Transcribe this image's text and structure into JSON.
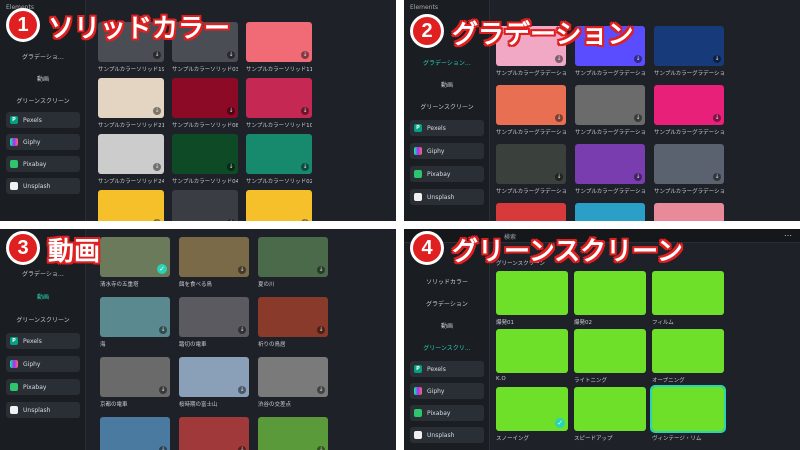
{
  "q1": {
    "badge": "1",
    "title": "ソリッドカラー",
    "side_head": "Elements",
    "side_items": [
      "グラデーショ…",
      "動画",
      "グリーンスクリーン"
    ],
    "sources": [
      "Pexels",
      "Giphy",
      "Pixabay",
      "Unsplash"
    ],
    "tiles": [
      {
        "label": "サンプルカラーソリッド19",
        "color": "#4a4d54"
      },
      {
        "label": "サンプルカラーソリッド03",
        "color": "#4a4d54"
      },
      {
        "label": "サンプルカラーソリッド11",
        "color": "#f06b75"
      },
      {
        "label": "サンプルカラーソリッド21",
        "color": "#e3d5c2"
      },
      {
        "label": "サンプルカラーソリッド08",
        "color": "#8c0a26"
      },
      {
        "label": "サンプルカラーソリッド10",
        "color": "#c42853"
      },
      {
        "label": "サンプルカラーソリッド24",
        "color": "#cccccc"
      },
      {
        "label": "サンプルカラーソリッド04",
        "color": "#0d4a25"
      },
      {
        "label": "サンプルカラーソリッド02",
        "color": "#178a6e"
      },
      {
        "label": "",
        "color": "#f5c02a"
      },
      {
        "label": "",
        "color": "#3a3d44"
      },
      {
        "label": "",
        "color": "#f5c02a"
      }
    ]
  },
  "q2": {
    "badge": "2",
    "title": "グラデーション",
    "side_head": "Elements",
    "side_items": [
      "グラデーション…",
      "動画",
      "グリーンスクリーン"
    ],
    "sources": [
      "Pexels",
      "Giphy",
      "Pixabay",
      "Unsplash"
    ],
    "tiles": [
      {
        "label": "サンプルカラーグラデーション…",
        "color": "#f0a8c4"
      },
      {
        "label": "サンプルカラーグラデーション…",
        "color": "#5a4cff"
      },
      {
        "label": "サンプルカラーグラデーション…",
        "color": "#163a7a"
      },
      {
        "label": "サンプルカラーグラデーション…",
        "color": "#e86f52"
      },
      {
        "label": "サンプルカラーグラデーション…",
        "color": "#6b6b6b"
      },
      {
        "label": "サンプルカラーグラデーション…",
        "color": "#e8207a"
      },
      {
        "label": "サンプルカラーグラデーション…",
        "color": "#3a403c"
      },
      {
        "label": "サンプルカラーグラデーション…",
        "color": "#7a3db0"
      },
      {
        "label": "サンプルカラーグラデーション…",
        "color": "#5a6270"
      },
      {
        "label": "",
        "color": "#d63a3a"
      },
      {
        "label": "",
        "color": "#2aa0c8"
      },
      {
        "label": "",
        "color": "#e88a9a"
      }
    ]
  },
  "q3": {
    "badge": "3",
    "title": "動画",
    "side_items": [
      "グラデーショ…",
      "動画",
      "グリーンスクリーン"
    ],
    "sources": [
      "Pexels",
      "Giphy",
      "Pixabay",
      "Unsplash"
    ],
    "tiles": [
      {
        "label": "清水寺の五重塔",
        "color": "#6a7a5a"
      },
      {
        "label": "餌を食べる鳥",
        "color": "#7a6a48"
      },
      {
        "label": "夏の川",
        "color": "#4a6a4a"
      },
      {
        "label": "海",
        "color": "#5a8a90"
      },
      {
        "label": "踏切の電車",
        "color": "#5a5a60"
      },
      {
        "label": "祈りの鳥居",
        "color": "#8a3a2a"
      },
      {
        "label": "京都の電車",
        "color": "#6a6a6a"
      },
      {
        "label": "桜時期の富士山",
        "color": "#8aa0b8"
      },
      {
        "label": "渋谷の交差点",
        "color": "#7a7a7a"
      },
      {
        "label": "",
        "color": "#4a7aa0"
      },
      {
        "label": "",
        "color": "#a03a3a"
      },
      {
        "label": "",
        "color": "#5a9a3a"
      }
    ]
  },
  "q4": {
    "badge": "4",
    "title": "グリーンスクリーン",
    "topbar_label": "検索",
    "side_items": [
      "ソリッドカラー",
      "グラデーション",
      "動画",
      "グリーンスクリ…"
    ],
    "sources": [
      "Pexels",
      "Giphy",
      "Pixabay",
      "Unsplash"
    ],
    "section_label": "グリーンスクリーン",
    "tiles": [
      {
        "label": "爆発01",
        "color": "#6ee02a"
      },
      {
        "label": "爆発02",
        "color": "#6ee02a"
      },
      {
        "label": "フィルム",
        "color": "#6ee02a"
      },
      {
        "label": "K.O",
        "color": "#6ee02a"
      },
      {
        "label": "ライトニング",
        "color": "#6ee02a"
      },
      {
        "label": "オープニング",
        "color": "#6ee02a"
      },
      {
        "label": "スノーイング",
        "color": "#6ee02a"
      },
      {
        "label": "スピードアップ",
        "color": "#6ee02a"
      },
      {
        "label": "ヴィンテージ・リム",
        "color": "#6ee02a"
      }
    ]
  }
}
